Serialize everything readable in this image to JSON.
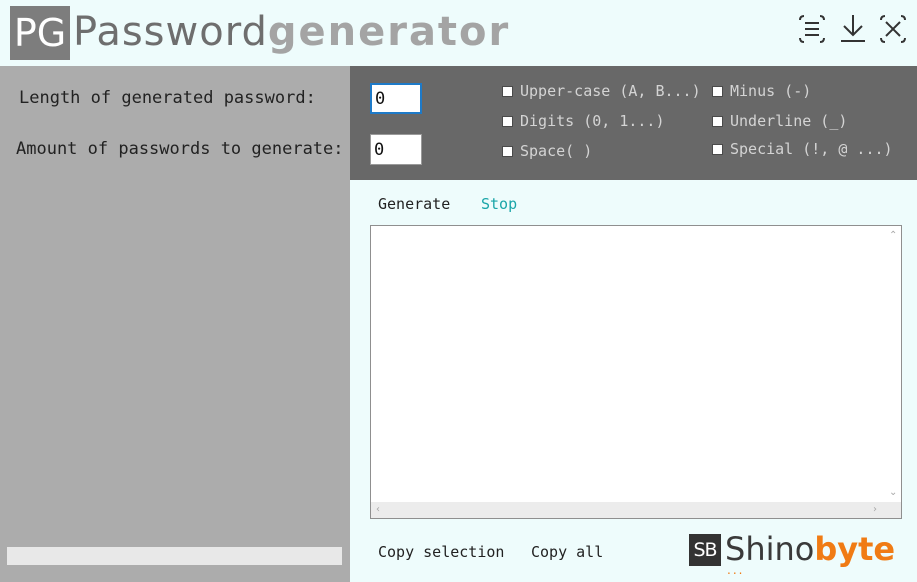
{
  "header": {
    "logo_text": "PG",
    "title_part1": "Password",
    "title_part2": "generator",
    "buttons": [
      {
        "name": "settings",
        "icon": "list-settings-icon"
      },
      {
        "name": "download",
        "icon": "download-icon"
      },
      {
        "name": "close",
        "icon": "close-icon"
      }
    ]
  },
  "form": {
    "length_label": "Length of generated password:",
    "length_value": "0",
    "amount_label": "Amount of passwords to generate:",
    "amount_value": "0"
  },
  "options": {
    "uppercase": "Upper-case (A, B...)",
    "digits": "Digits (0, 1...)",
    "space": "Space( )",
    "minus": "Minus (-)",
    "underline": "Underline (_)",
    "special": "Special (!, @ ...)"
  },
  "actions": {
    "generate": "Generate",
    "stop": "Stop",
    "copy_selection": "Copy selection",
    "copy_all": "Copy all"
  },
  "output": {
    "content": ""
  },
  "brand": {
    "box": "SB",
    "word1": "Shino",
    "word2": "byte",
    "dots": "..."
  },
  "colors": {
    "background": "#eefcfc",
    "left_panel": "#acacac",
    "settings_bar": "#686868",
    "accent_stop": "#1aa5a8",
    "brand_orange": "#f07b14"
  }
}
